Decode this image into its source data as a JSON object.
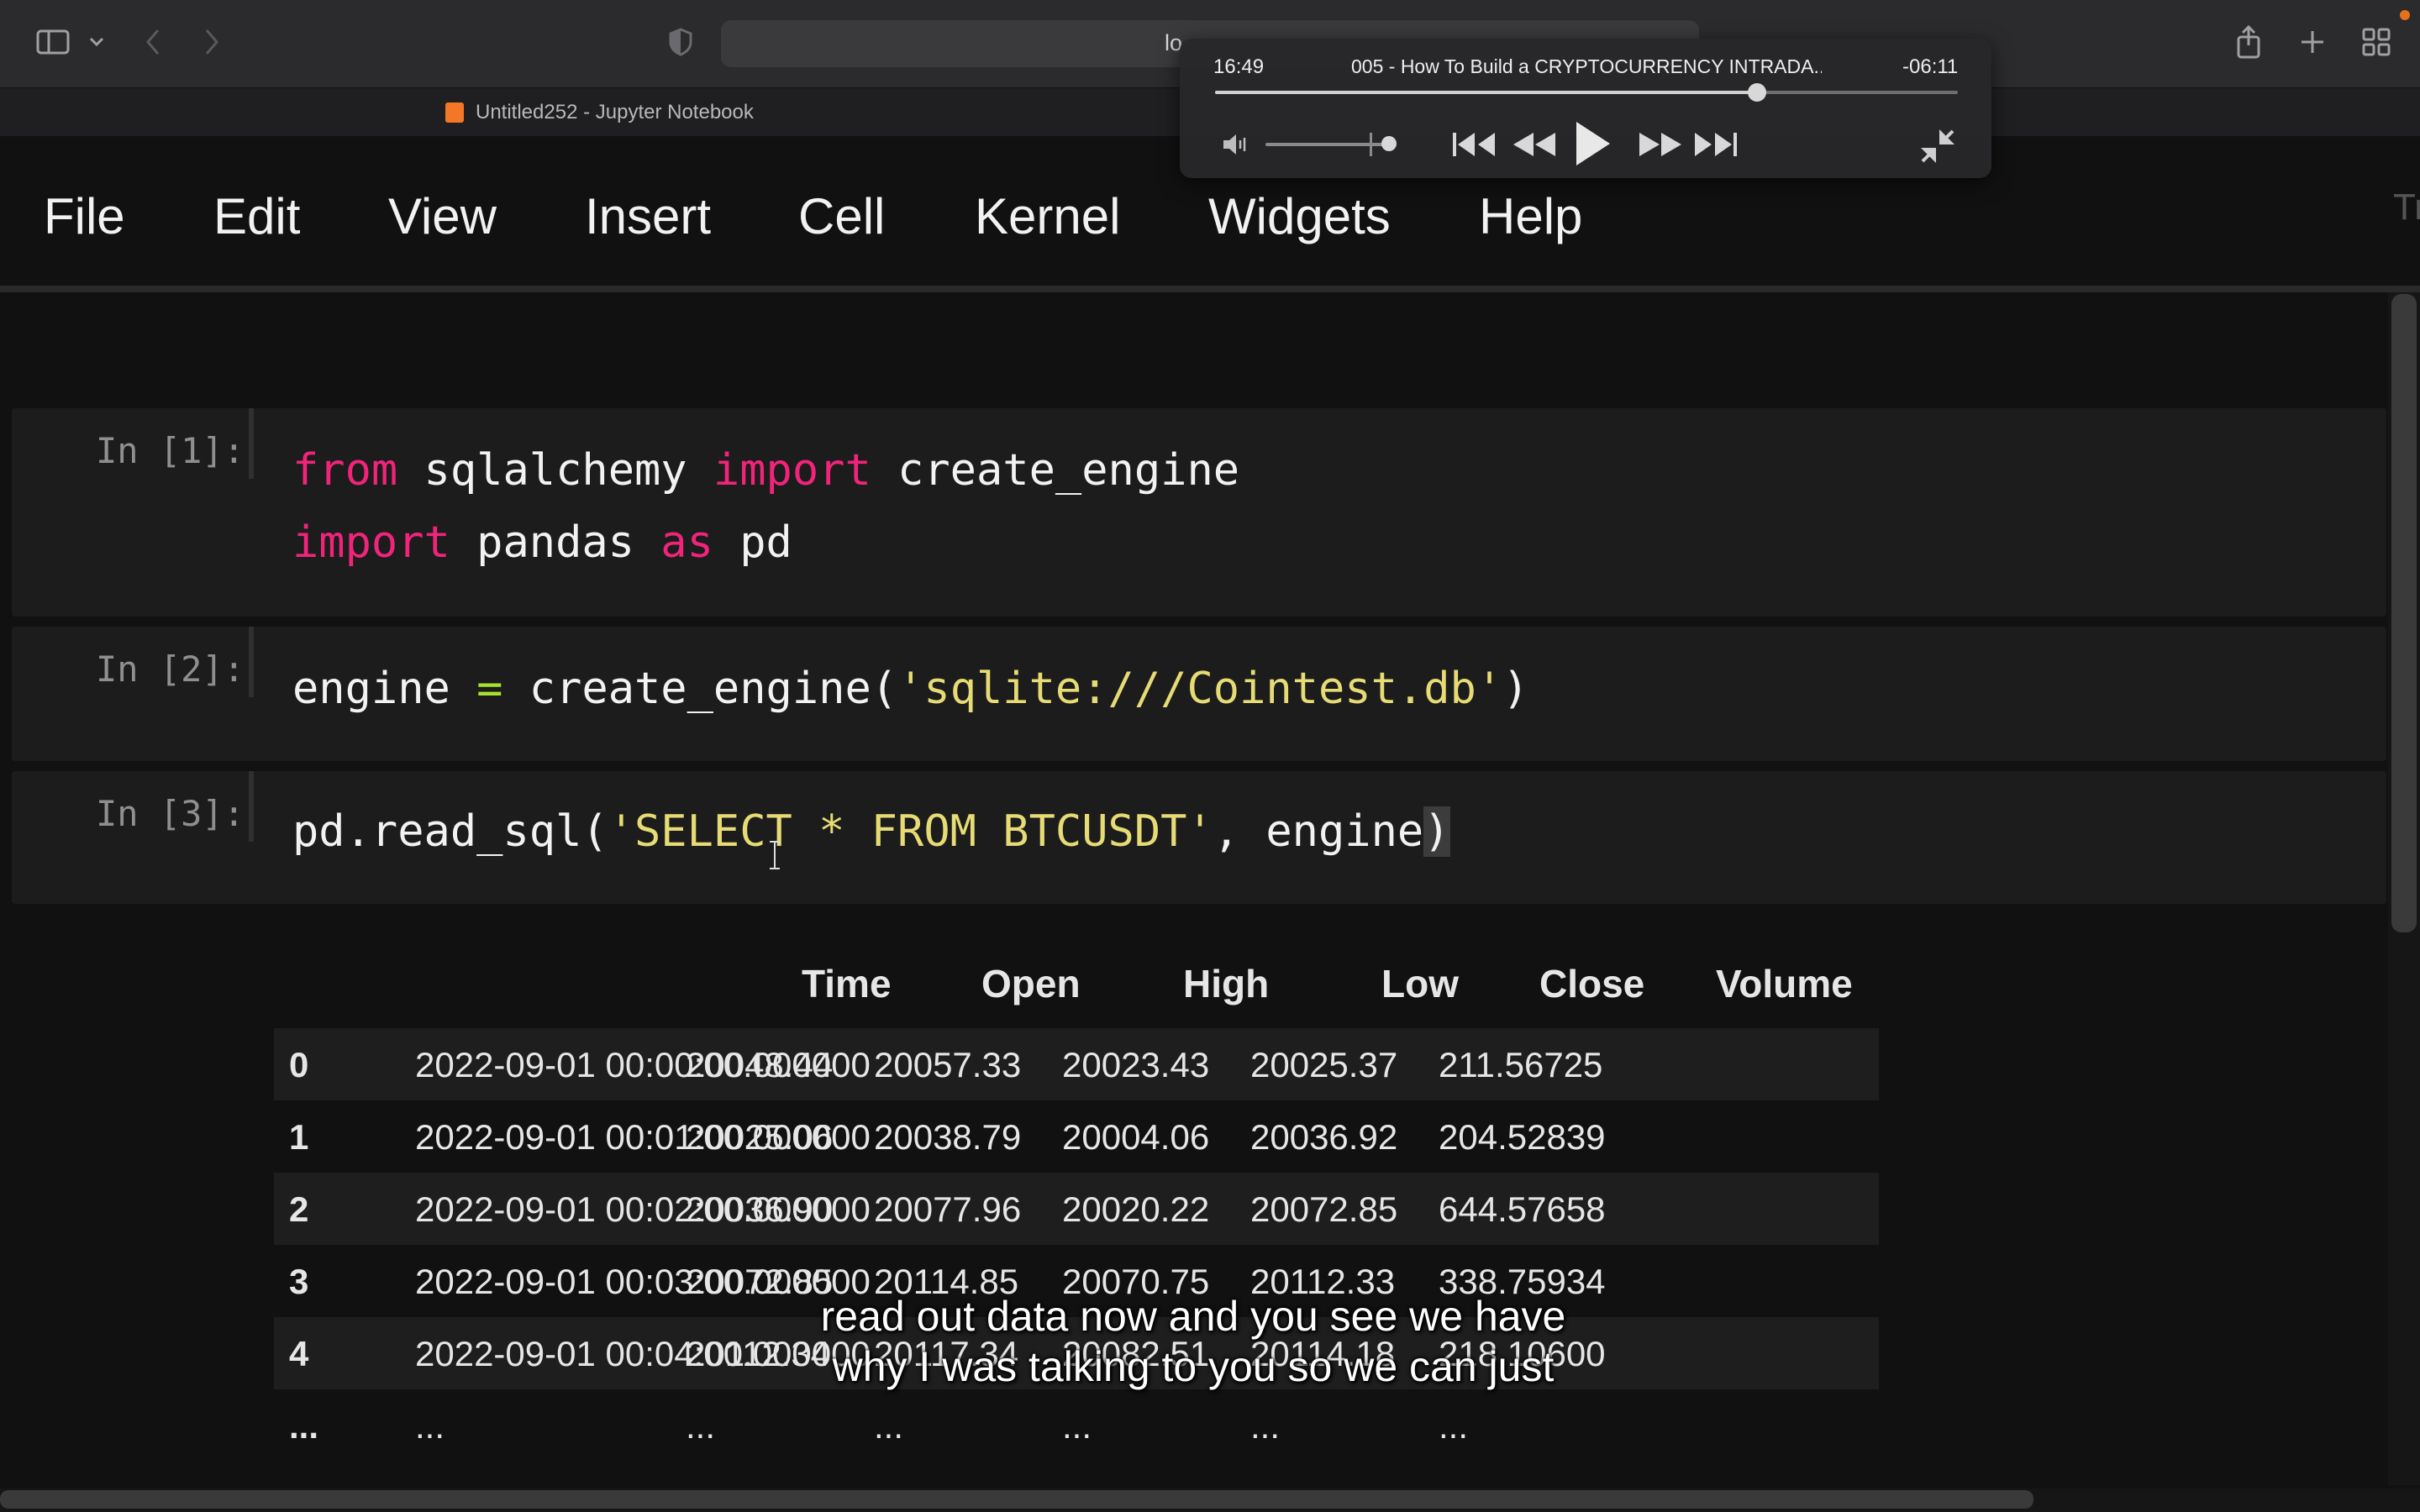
{
  "browser": {
    "url_visible": "lo",
    "tab_title": "Untitled252 - Jupyter Notebook"
  },
  "menu": {
    "items": [
      "File",
      "Edit",
      "View",
      "Insert",
      "Cell",
      "Kernel",
      "Widgets",
      "Help"
    ],
    "edge_text": "Tr"
  },
  "cells": [
    {
      "prompt": "In [1]:",
      "lines": [
        [
          {
            "t": "from",
            "c": "kw"
          },
          {
            "t": " sqlalchemy "
          },
          {
            "t": "import",
            "c": "kw"
          },
          {
            "t": " create_engine"
          }
        ],
        [
          {
            "t": "import",
            "c": "kw"
          },
          {
            "t": " pandas "
          },
          {
            "t": "as",
            "c": "kw"
          },
          {
            "t": " pd"
          }
        ]
      ]
    },
    {
      "prompt": "In [2]:",
      "lines": [
        [
          {
            "t": "engine "
          },
          {
            "t": "=",
            "c": "op"
          },
          {
            "t": " create_engine("
          },
          {
            "t": "'sqlite:///Cointest.db'",
            "c": "str"
          },
          {
            "t": ")"
          }
        ]
      ]
    },
    {
      "prompt": "In [3]:",
      "lines": [
        [
          {
            "t": "pd.read_sql("
          },
          {
            "t": "'SELECT * FROM BTCUSDT'",
            "c": "str"
          },
          {
            "t": ", engine"
          },
          {
            "t": ")",
            "c": "paren-hl"
          }
        ]
      ]
    }
  ],
  "dataframe": {
    "columns": [
      "Time",
      "Open",
      "High",
      "Low",
      "Close",
      "Volume"
    ],
    "rows": [
      [
        "0",
        "2022-09-01 00:00:00.000000",
        "20048.44",
        "20057.33",
        "20023.43",
        "20025.37",
        "211.56725"
      ],
      [
        "1",
        "2022-09-01 00:01:00.000000",
        "20025.06",
        "20038.79",
        "20004.06",
        "20036.92",
        "204.52839"
      ],
      [
        "2",
        "2022-09-01 00:02:00.000000",
        "20036.90",
        "20077.96",
        "20020.22",
        "20072.85",
        "644.57658"
      ],
      [
        "3",
        "2022-09-01 00:03:00.000000",
        "20072.85",
        "20114.85",
        "20070.75",
        "20112.33",
        "338.75934"
      ],
      [
        "4",
        "2022-09-01 00:04:00.000000",
        "20112.34",
        "20117.34",
        "20082.51",
        "20114.18",
        "218.10600"
      ],
      [
        "...",
        "...",
        "...",
        "...",
        "...",
        "...",
        "..."
      ]
    ]
  },
  "player": {
    "elapsed": "16:49",
    "title": "005 - How To Build a CRYPTOCURRENCY INTRADA...",
    "remaining": "-06:11",
    "progress_fraction": 0.73,
    "icons": [
      "volume-icon",
      "skip-back-icon",
      "rewind-icon",
      "play-icon",
      "fast-forward-icon",
      "skip-forward-icon",
      "exit-fullscreen-icon"
    ]
  },
  "subtitles": {
    "line1": "read out data now and you see we have",
    "line2": "why I was talking to you so we can just"
  }
}
